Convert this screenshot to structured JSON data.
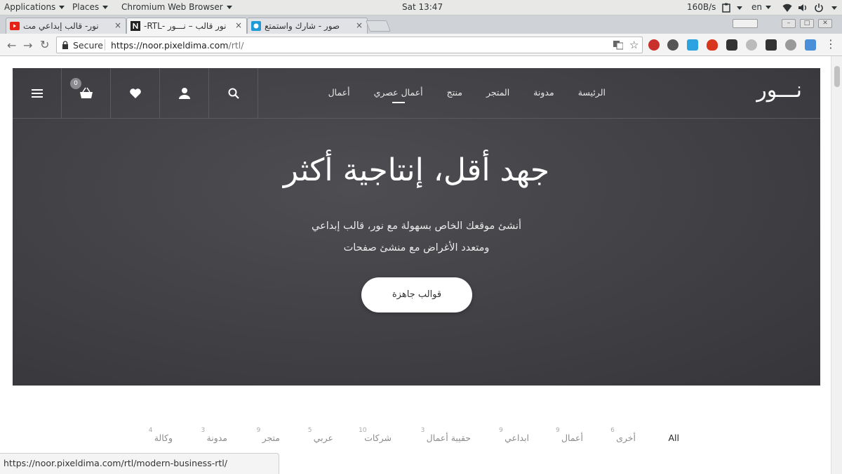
{
  "system_bar": {
    "applications": "Applications",
    "places": "Places",
    "app_name": "Chromium Web Browser",
    "clock": "Sat 13:47",
    "net_speed": "160B/s",
    "language": "en"
  },
  "tabs": [
    {
      "title": "نور- قالب إبداعي مت",
      "active": false,
      "favicon": "youtube-favicon"
    },
    {
      "title": "نور قالب – نـــور -RTL-",
      "active": true,
      "favicon": "n-favicon"
    },
    {
      "title": "صور - شارك واستمتع",
      "active": false,
      "favicon": "image-favicon"
    }
  ],
  "tab_close": "×",
  "omnibox": {
    "secure_label": "Secure",
    "url_host": "https://noor.pixeldima.com",
    "url_path": "/rtl/"
  },
  "site": {
    "logo": "نـــور",
    "nav": [
      "الرئيسة",
      "مدونة",
      "المتجر",
      "منتج",
      "أعمال عصري",
      "أعمال"
    ],
    "current_nav_index": 4,
    "cart_count": "0",
    "hero_title": "جهد أقل، إنتاجية أكثر",
    "hero_line1": "أنشئ موقعك الخاص بسهولة مع نور، قالب إبداعي",
    "hero_line2": "ومتعدد الأغراض مع منشئ صفحات",
    "hero_button": "قوالب جاهزة",
    "filters": [
      {
        "label": "All",
        "count": ""
      },
      {
        "label": "أخرى",
        "count": "6"
      },
      {
        "label": "أعمال",
        "count": "9"
      },
      {
        "label": "ابداعي",
        "count": "9"
      },
      {
        "label": "حقيبة أعمال",
        "count": "3"
      },
      {
        "label": "شركات",
        "count": "10"
      },
      {
        "label": "عربي",
        "count": "5"
      },
      {
        "label": "متجر",
        "count": "9"
      },
      {
        "label": "مدونة",
        "count": "3"
      },
      {
        "label": "وكالة",
        "count": "4"
      }
    ]
  },
  "status_url": "https://noor.pixeldima.com/rtl/modern-business-rtl/",
  "colors": {
    "hero_bg": "#434347",
    "badge": "#8b8b8f"
  }
}
